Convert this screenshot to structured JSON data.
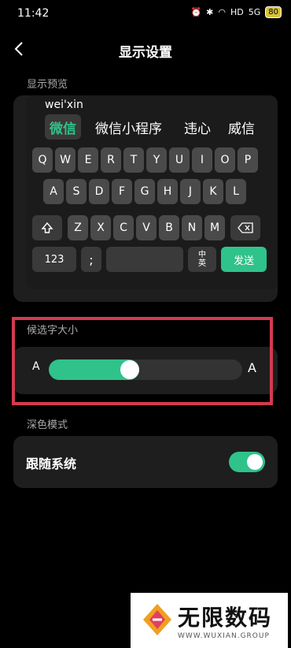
{
  "status": {
    "time": "11:42",
    "battery": "80",
    "hd": "HD",
    "signal": "5G"
  },
  "header": {
    "title": "显示设置"
  },
  "preview": {
    "label": "显示预览",
    "pinyin": "wei'xin",
    "candidates": [
      "微信",
      "微信小程序",
      "违心",
      "威信"
    ],
    "rows": [
      [
        "Q",
        "W",
        "E",
        "R",
        "T",
        "Y",
        "U",
        "I",
        "O",
        "P"
      ],
      [
        "A",
        "S",
        "D",
        "F",
        "G",
        "H",
        "J",
        "K",
        "L"
      ],
      [
        "Z",
        "X",
        "C",
        "V",
        "B",
        "N",
        "M"
      ]
    ],
    "key_123": "123",
    "key_punct": ";",
    "key_lang_top": "中",
    "key_lang_bottom": "英",
    "key_send": "发送"
  },
  "font_size": {
    "label": "候选字大小",
    "left_a": "A",
    "right_a": "A",
    "level": 0.41
  },
  "dark_mode": {
    "label": "深色模式",
    "follow_system": "跟随系统",
    "enabled": true
  },
  "watermark": {
    "text": "无限数码",
    "sub": "WWW.WUXIAN.GROUP"
  },
  "colors": {
    "accent": "#2fc28b",
    "highlight": "#d43a4f"
  }
}
